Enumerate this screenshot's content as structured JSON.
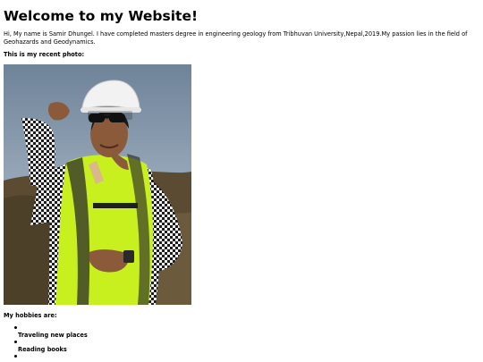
{
  "page": {
    "title": "Welcome to my Website!",
    "intro": "Hi, My name is Samir Dhungel. I have completed masters degree in engineering geology from Tribhuvan University,Nepal,2019.My passion lies in the field of Geohazards and Geodynamics.",
    "photo_heading": "This is my recent photo:",
    "hobbies_heading": "My hobbies are:",
    "hobbies": [
      "Traveling new places",
      "Reading books",
      ""
    ]
  },
  "colors": {
    "text": "#000000",
    "background": "#ffffff",
    "sky": "#8fa3b8",
    "safety_vest": "#c8f01e",
    "helmet": "#f2f2f2"
  }
}
